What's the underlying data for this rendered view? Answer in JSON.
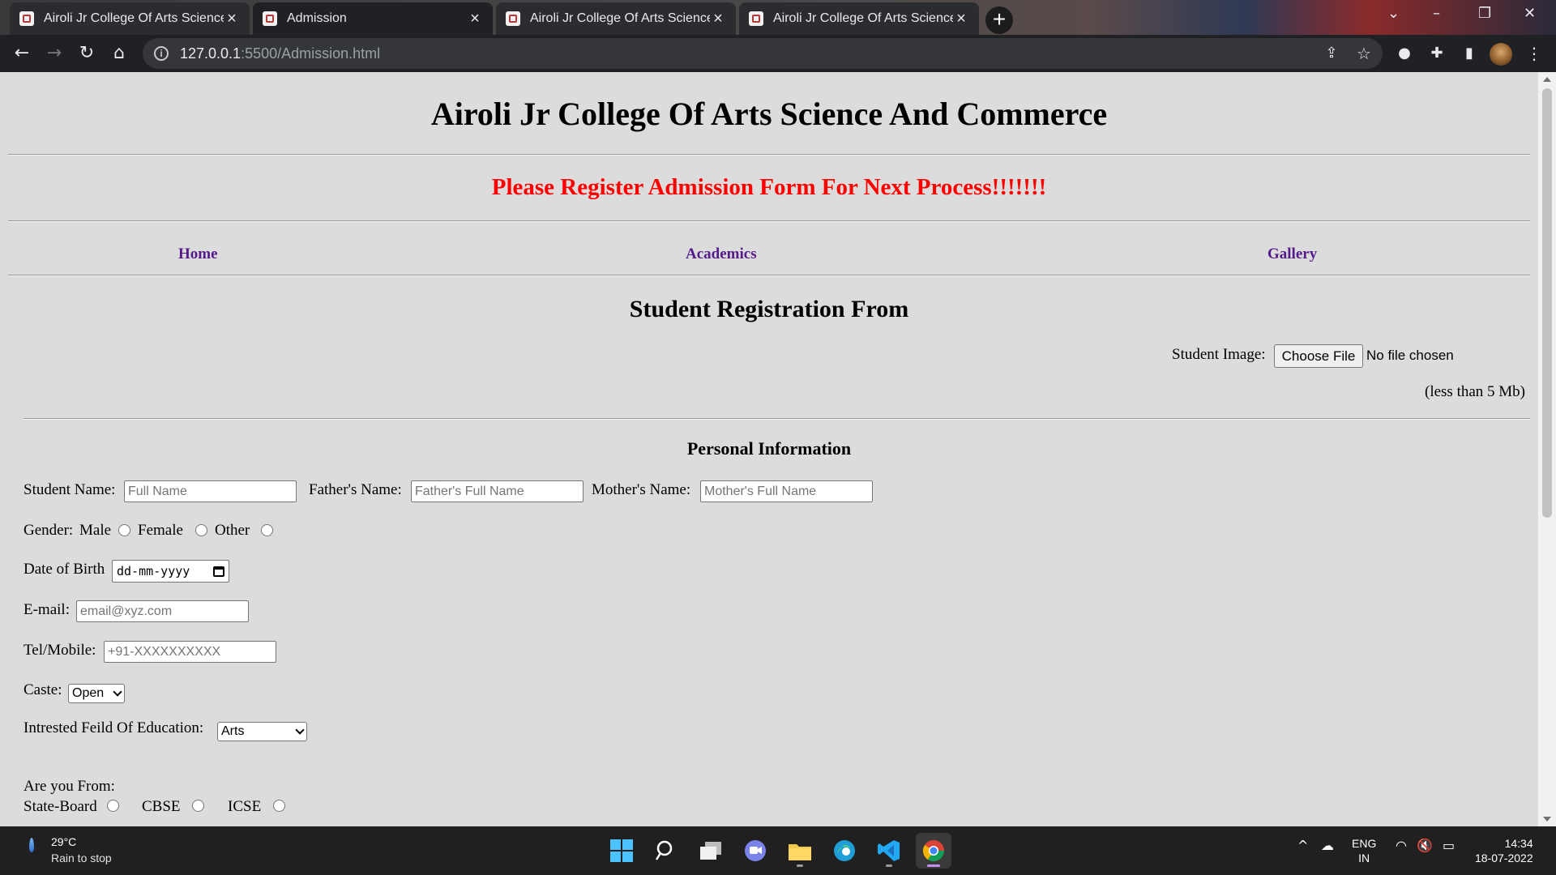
{
  "browser": {
    "tabs": [
      {
        "title": "Airoli Jr College Of Arts Science And Commerce",
        "active": false
      },
      {
        "title": "Admission",
        "active": true
      },
      {
        "title": "Airoli Jr College Of Arts Science And Commerce",
        "active": false
      },
      {
        "title": "Airoli Jr College Of Arts Science And Commerce",
        "active": false
      }
    ],
    "new_tab": "+",
    "url_host": "127.0.0.1",
    "url_rest": ":5500/Admission.html"
  },
  "page": {
    "college_title": "Airoli Jr College Of Arts Science And Commerce",
    "notice": "Please Register Admission Form For Next Process!!!!!!!",
    "nav": [
      "Home",
      "Academics",
      "Gallery"
    ],
    "form_title": "Student Registration From",
    "student_image": {
      "label": "Student Image:",
      "button": "Choose File",
      "status": "No file chosen",
      "hint": "(less than 5 Mb)"
    },
    "personal_info_title": "Personal Information",
    "student_name": {
      "label": "Student Name:",
      "placeholder": "Full Name"
    },
    "father_name": {
      "label": "Father's Name:",
      "placeholder": "Father's Full Name"
    },
    "mother_name": {
      "label": "Mother's Name:",
      "placeholder": "Mother's Full Name"
    },
    "gender": {
      "label": "Gender:",
      "options": [
        "Male",
        "Female",
        "Other"
      ]
    },
    "dob": {
      "label": "Date of Birth",
      "placeholder": "dd-mm-yyyy"
    },
    "email": {
      "label": "E-mail:",
      "placeholder": "email@xyz.com"
    },
    "phone": {
      "label": "Tel/Mobile:",
      "placeholder": "+91-XXXXXXXXXX"
    },
    "caste": {
      "label": "Caste:",
      "value": "Open"
    },
    "field": {
      "label": "Intrested Feild Of Education:",
      "value": "Arts"
    },
    "board": {
      "label": "Are you From:",
      "options": [
        "State-Board",
        "CBSE",
        "ICSE"
      ]
    }
  },
  "taskbar": {
    "weather_temp": "29°C",
    "weather_desc": "Rain to stop",
    "lang_top": "ENG",
    "lang_bottom": "IN",
    "time": "14:34",
    "date": "18-07-2022"
  },
  "colors": {
    "notice": "#ff0000",
    "nav_link": "#551a8b",
    "page_bg": "#dcdcdc"
  }
}
